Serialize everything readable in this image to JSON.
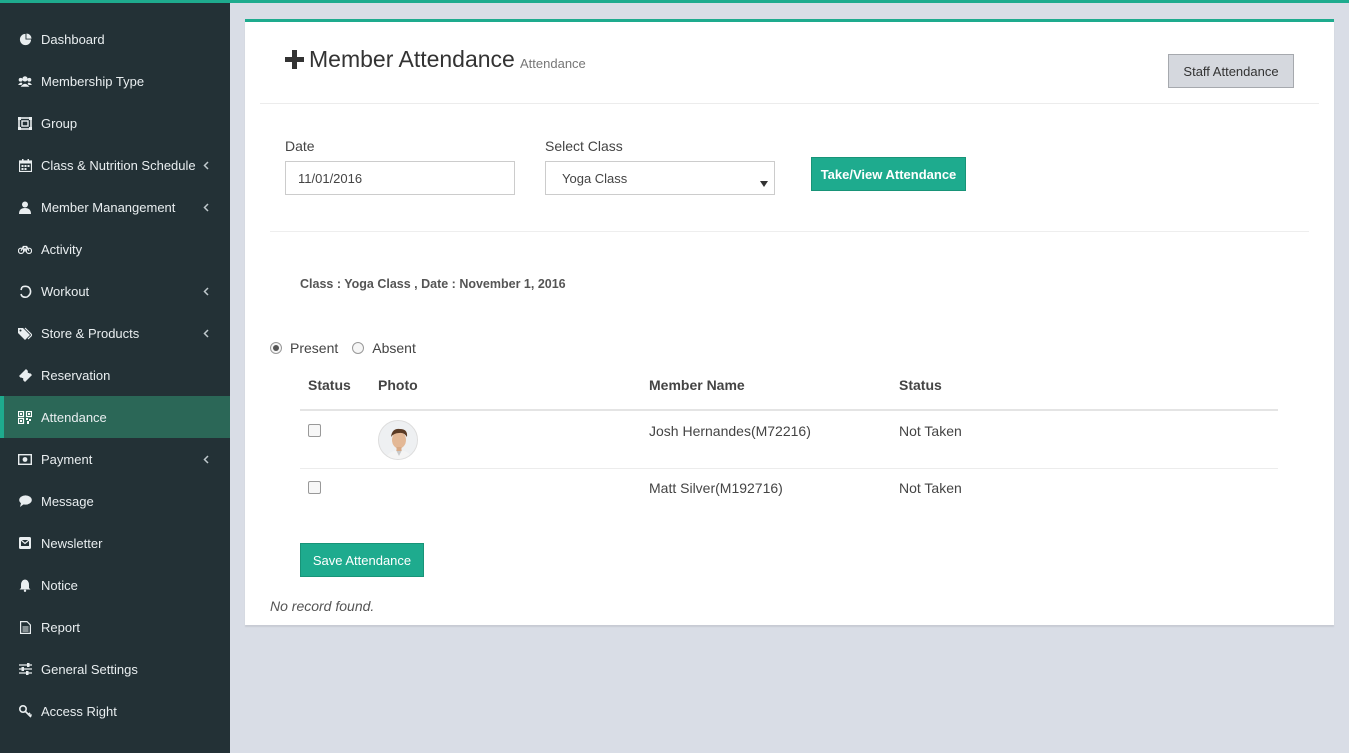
{
  "sidebar": {
    "items": [
      {
        "label": "Dashboard",
        "icon": "dashboard-icon",
        "has_submenu": false
      },
      {
        "label": "Membership Type",
        "icon": "users-icon",
        "has_submenu": false
      },
      {
        "label": "Group",
        "icon": "group-icon",
        "has_submenu": false
      },
      {
        "label": "Class & Nutrition Schedule",
        "icon": "calendar-icon",
        "has_submenu": true
      },
      {
        "label": "Member Manangement",
        "icon": "user-icon",
        "has_submenu": true
      },
      {
        "label": "Activity",
        "icon": "bicycle-icon",
        "has_submenu": false
      },
      {
        "label": "Workout",
        "icon": "workout-icon",
        "has_submenu": true
      },
      {
        "label": "Store & Products",
        "icon": "tags-icon",
        "has_submenu": true
      },
      {
        "label": "Reservation",
        "icon": "ticket-icon",
        "has_submenu": false
      },
      {
        "label": "Attendance",
        "icon": "qrcode-icon",
        "has_submenu": false,
        "active": true
      },
      {
        "label": "Payment",
        "icon": "money-icon",
        "has_submenu": true
      },
      {
        "label": "Message",
        "icon": "comment-icon",
        "has_submenu": false
      },
      {
        "label": "Newsletter",
        "icon": "envelope-icon",
        "has_submenu": false
      },
      {
        "label": "Notice",
        "icon": "bell-icon",
        "has_submenu": false
      },
      {
        "label": "Report",
        "icon": "file-icon",
        "has_submenu": false
      },
      {
        "label": "General Settings",
        "icon": "sliders-icon",
        "has_submenu": false
      },
      {
        "label": "Access Right",
        "icon": "key-icon",
        "has_submenu": false
      }
    ]
  },
  "header": {
    "title": "Member Attendance",
    "subtitle": "Attendance",
    "staff_button": "Staff Attendance"
  },
  "form": {
    "date_label": "Date",
    "date_value": "11/01/2016",
    "class_label": "Select Class",
    "class_value": "Yoga Class",
    "submit_button": "Take/View Attendance"
  },
  "class_info": "Class : Yoga Class , Date : November 1, 2016",
  "attendance_options": {
    "present": "Present",
    "absent": "Absent",
    "selected": "Present"
  },
  "table": {
    "headers": [
      "Status",
      "Photo",
      "Member Name",
      "Status"
    ],
    "rows": [
      {
        "name": "Josh Hernandes(M72216)",
        "status": "Not Taken",
        "has_photo": true
      },
      {
        "name": "Matt Silver(M192716)",
        "status": "Not Taken",
        "has_photo": false
      }
    ]
  },
  "save_button": "Save Attendance",
  "no_record": "No record found.",
  "colors": {
    "accent": "#1eab8e",
    "sidebar_bg": "#233136",
    "sidebar_active": "#2b6757",
    "page_bg": "#d9dde6"
  }
}
